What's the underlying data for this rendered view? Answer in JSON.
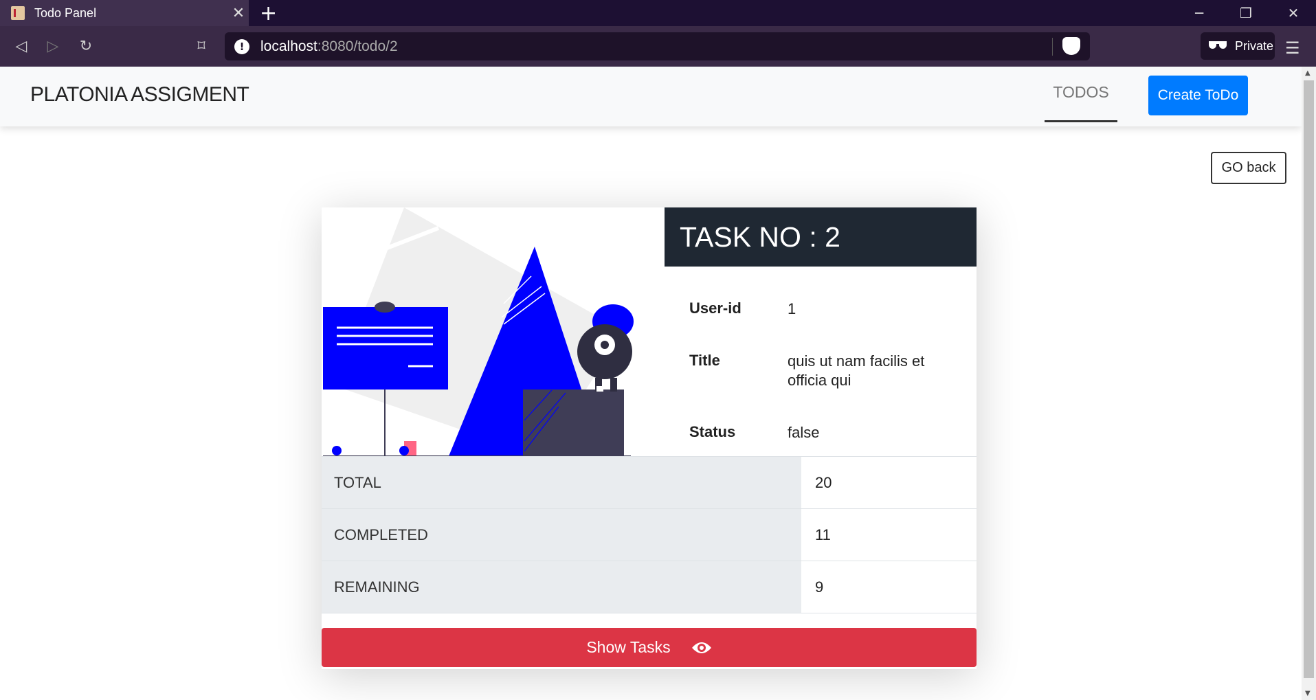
{
  "browser": {
    "tab_title": "Todo Panel",
    "url_host": "localhost",
    "url_rest": ":8080/todo/2",
    "private_label": "Private"
  },
  "app": {
    "brand": "PLATONIA ASSIGMENT",
    "nav_todos": "TODOS",
    "create_button": "Create ToDo",
    "go_back": "GO back"
  },
  "task": {
    "heading": "TASK NO : 2",
    "fields": [
      {
        "label": "User-id",
        "value": "1"
      },
      {
        "label": "Title",
        "value": "quis ut nam facilis et officia qui"
      },
      {
        "label": "Status",
        "value": "false"
      }
    ]
  },
  "stats": [
    {
      "label": "TOTAL",
      "value": "20"
    },
    {
      "label": "COMPLETED",
      "value": "11"
    },
    {
      "label": "REMAINING",
      "value": "9"
    }
  ],
  "show_tasks_button": "Show Tasks",
  "icons": {
    "favicon": "notebook-icon",
    "eye": "eye-icon"
  },
  "colors": {
    "primary": "#007bff",
    "danger": "#dc3545",
    "dark": "#1f2833",
    "illustration_blue": "#0000ff"
  }
}
